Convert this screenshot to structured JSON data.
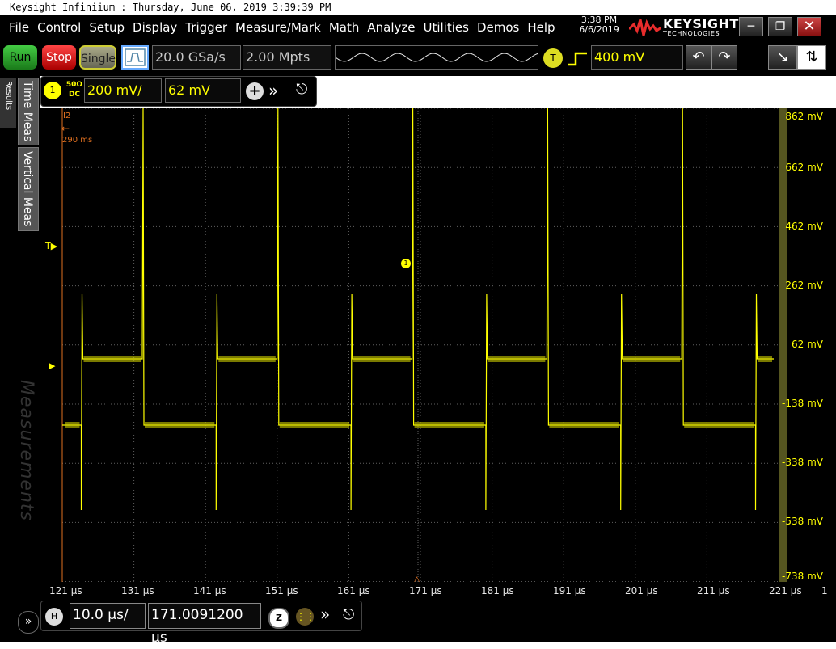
{
  "window": {
    "title": "Keysight Infiniium : Thursday, June 06, 2019 3:39:39 PM",
    "time": "3:38 PM",
    "date": "6/6/2019",
    "logo": "KEYSIGHT",
    "logo_sub": "TECHNOLOGIES",
    "min_icon": "minimize-icon",
    "max_icon": "maximize-icon",
    "close_icon": "close-icon"
  },
  "menu": [
    "File",
    "Control",
    "Setup",
    "Display",
    "Trigger",
    "Measure/Mark",
    "Math",
    "Analyze",
    "Utilities",
    "Demos",
    "Help"
  ],
  "toolbar": {
    "run": "Run",
    "stop": "Stop",
    "single": "Single",
    "sample_rate": "20.0 GSa/s",
    "memory_depth": "2.00 Mpts",
    "trigger_badge": "T",
    "trigger_level": "400 mV"
  },
  "sidebar": {
    "results_tab": "Results",
    "tab_time": "Time Meas",
    "tab_vertical": "Vertical Meas",
    "measurements_label": "Measurements"
  },
  "channel": {
    "number": "1",
    "impedance": "50Ω",
    "coupling": "DC",
    "scale": "200 mV/",
    "offset": "62 mV"
  },
  "plot": {
    "marker_label": "I2",
    "marker_time": "290 ms",
    "trigger_marker": "T",
    "channel_marker": "1",
    "waveform_color": "#ffff00",
    "grid_color": "#606060"
  },
  "y_axis_labels": [
    "862 mV",
    "662 mV",
    "462 mV",
    "262 mV",
    "62 mV",
    "-138 mV",
    "-338 mV",
    "-538 mV",
    "-738 mV"
  ],
  "x_axis_labels": [
    "121 µs",
    "131 µs",
    "141 µs",
    "151 µs",
    "161 µs",
    "171 µs",
    "181 µs",
    "191 µs",
    "201 µs",
    "211 µs",
    "221 µs"
  ],
  "x_axis_extra": "1",
  "horizontal": {
    "badge": "H",
    "scale": "10.0 µs/",
    "position": "171.0091200 µs",
    "zoom_badge": "Z"
  }
}
